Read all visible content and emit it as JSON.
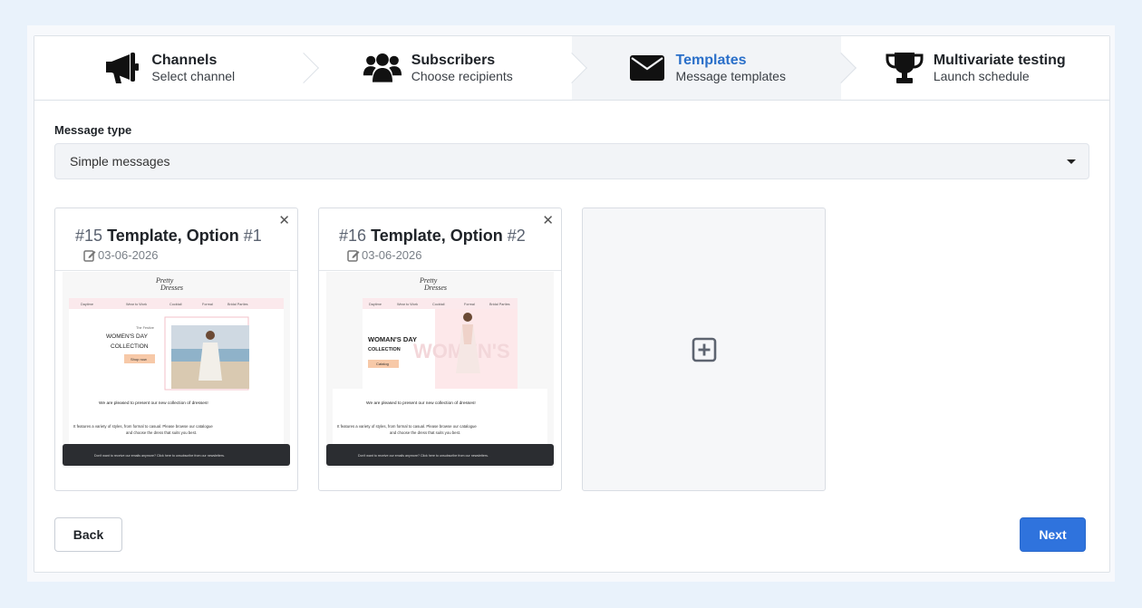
{
  "steps": [
    {
      "title": "Channels",
      "subtitle": "Select channel",
      "icon": "megaphone-icon",
      "active": false
    },
    {
      "title": "Subscribers",
      "subtitle": "Choose recipients",
      "icon": "users-icon",
      "active": false
    },
    {
      "title": "Templates",
      "subtitle": "Message templates",
      "icon": "envelope-icon",
      "active": true
    },
    {
      "title": "Multivariate testing",
      "subtitle": "Launch schedule",
      "icon": "trophy-icon",
      "active": false
    }
  ],
  "message_type": {
    "label": "Message type",
    "selected": "Simple messages"
  },
  "templates": [
    {
      "num_prefix": "#15",
      "title": "Template, Option",
      "option": "#1",
      "date": "03-06-2026",
      "preview": {
        "logo_line1": "Pretty",
        "logo_line2": "Dresses",
        "menu": [
          "Daytime",
          "Wear to Work",
          "Cocktail",
          "Formal",
          "Bridal Parties"
        ],
        "kicker": "The Festive",
        "headline_line1": "WOMEN'S DAY",
        "headline_line2": "COLLECTION",
        "cta": "Shop now",
        "intro": "We are pleased to present our new collection of dresses!",
        "body_line1": "It features a variety of styles, from formal to casual. Please browse our catalogue",
        "body_line2": "and choose the dress that suits you best.",
        "footer": "Don't want to receive our emails anymore? Click here to unsubscribe from our newsletters."
      }
    },
    {
      "num_prefix": "#16",
      "title": "Template, Option",
      "option": "#2",
      "date": "03-06-2026",
      "preview": {
        "logo_line1": "Pretty",
        "logo_line2": "Dresses",
        "menu": [
          "Daytime",
          "Wear to Work",
          "Cocktail",
          "Formal",
          "Bridal Parties"
        ],
        "headline_line1": "WOMAN'S DAY",
        "headline_line2": "COLLECTION",
        "watermark": "WOMEN'S",
        "cta": "Catalog",
        "intro": "We are pleased to present our new collection of dresses!",
        "body_line1": "It features a variety of styles, from formal to casual. Please browse our catalogue",
        "body_line2": "and choose the dress that suits you best.",
        "footer": "Don't want to receive our emails anymore? Click here to unsubscribe from our newsletters."
      }
    }
  ],
  "add_template": {
    "icon": "plus-square-icon"
  },
  "buttons": {
    "back": "Back",
    "next": "Next"
  },
  "colors": {
    "accent": "#2f73dd",
    "active_step_title": "#2a6fc9"
  }
}
